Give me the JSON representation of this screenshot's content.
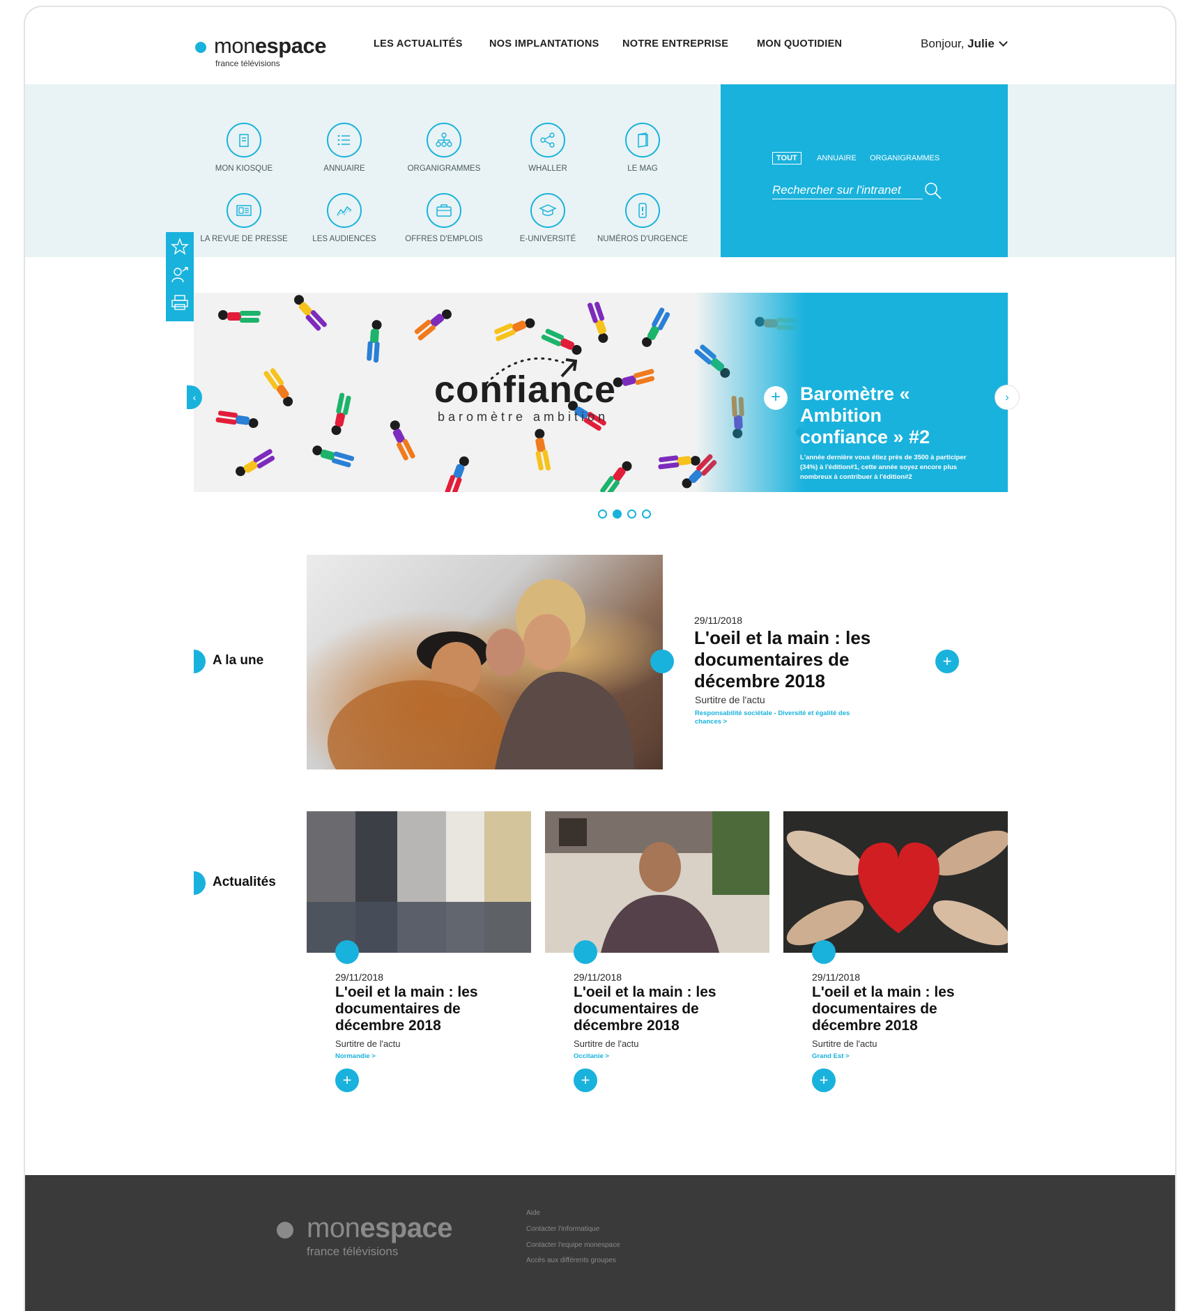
{
  "header": {
    "logo_light": "mon",
    "logo_bold": "espace",
    "logo_sub": "france télévisions",
    "nav": [
      "LES ACTUALITÉS",
      "NOS IMPLANTATIONS",
      "NOTRE ENTREPRISE",
      "MON QUOTIDIEN"
    ],
    "greeting": "Bonjour,",
    "user": "Julie"
  },
  "tools": [
    {
      "label": "MON KIOSQUE",
      "icon": "kiosk-icon"
    },
    {
      "label": "ANNUAIRE",
      "icon": "list-icon"
    },
    {
      "label": "ORGANIGRAMMES",
      "icon": "org-chart-icon"
    },
    {
      "label": "WHALLER",
      "icon": "share-icon"
    },
    {
      "label": "LE MAG",
      "icon": "magazine-icon"
    },
    {
      "label": "LA REVUE DE PRESSE",
      "icon": "newspaper-icon"
    },
    {
      "label": "LES AUDIENCES",
      "icon": "chart-icon"
    },
    {
      "label": "OFFRES D'EMPLOIS",
      "icon": "briefcase-icon"
    },
    {
      "label": "E-UNIVERSITÉ",
      "icon": "graduation-cap-icon"
    },
    {
      "label": "NUMÉROS D'URGENCE",
      "icon": "phone-icon"
    }
  ],
  "search": {
    "filters": [
      "TOUT",
      "ANNUAIRE",
      "ORGANIGRAMMES"
    ],
    "placeholder": "Rechercher sur l'intranet"
  },
  "hero": {
    "logo_text": "confiance",
    "logo_sub": "baromètre ambition",
    "title": "Baromètre « Ambition confiance » #2",
    "desc": "L'année dernière vous étiez près de 3500 à participer (34%) à l'édition#1, cette année soyez encore plus nombreux à contribuer à l'édition#2",
    "plus": "+",
    "prev": "‹",
    "next": "›",
    "active_slide": 2,
    "slide_count": 4
  },
  "une": {
    "section": "A la une",
    "date": "29/11/2018",
    "title": "L'oeil et la main : les documentaires de décembre 2018",
    "subtitle": "Surtitre de l'actu",
    "category": "Responsabilité sociétale - Diversité et égalité des chances >",
    "plus": "+"
  },
  "actualites": {
    "section": "Actualités",
    "cards": [
      {
        "date": "29/11/2018",
        "title": "L'oeil et la main : les documentaires de décembre 2018",
        "subtitle": "Surtitre de l'actu",
        "category": "Normandie >",
        "plus": "+"
      },
      {
        "date": "29/11/2018",
        "title": "L'oeil et la main : les documentaires de décembre 2018",
        "subtitle": "Surtitre de l'actu",
        "category": "Occitanie   >",
        "plus": "+"
      },
      {
        "date": "29/11/2018",
        "title": "L'oeil et la main : les documentaires de décembre 2018",
        "subtitle": "Surtitre de l'actu",
        "category": "Grand Est   >",
        "plus": "+"
      }
    ]
  },
  "footer": {
    "logo_light": "mon",
    "logo_bold": "espace",
    "logo_sub": "france télévisions",
    "links": [
      "Aide",
      "Contacter l'informatique",
      "Contacter l'equipe monespace",
      "Accès aux différents groupes"
    ]
  },
  "colors": {
    "accent": "#19b2dc",
    "band": "#e9f3f5",
    "footer": "#3a3a3a"
  }
}
